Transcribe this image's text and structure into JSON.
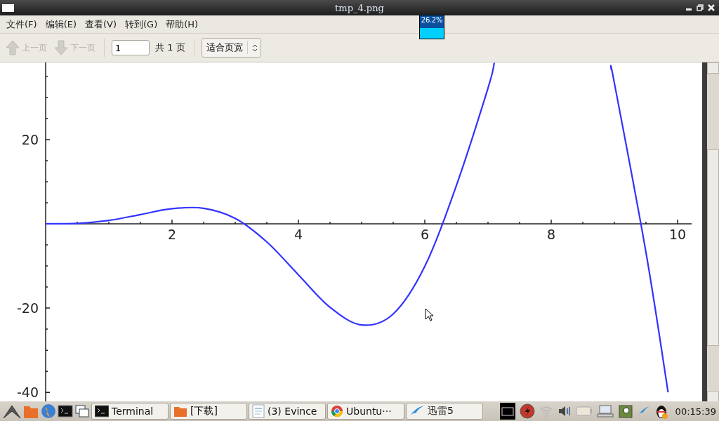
{
  "window": {
    "title": "tmp_4.png"
  },
  "menu": [
    "文件(F)",
    "编辑(E)",
    "查看(V)",
    "转到(G)",
    "帮助(H)"
  ],
  "toolbar": {
    "prev": {
      "label": "上一页",
      "disabled": true
    },
    "next": {
      "label": "下一页",
      "disabled": true
    },
    "page_field": {
      "value": "1"
    },
    "page_count": "共 1 页",
    "zoom": {
      "value": "适合页宽"
    }
  },
  "cpu_monitor": {
    "reading": "26.2%"
  },
  "document": {
    "chart_data": {
      "type": "line",
      "x": [
        0,
        0.5,
        1,
        1.5,
        2,
        2.5,
        3,
        3.5,
        4,
        4.5,
        5,
        5.5,
        6,
        6.5,
        7,
        7.1,
        8.95,
        9,
        9.5,
        9.85
      ],
      "series": [
        {
          "color": "#3333ff",
          "values": [
            0,
            0.1,
            0.8,
            2.2,
            3.6,
            3.7,
            1.3,
            -4.3,
            -12.1,
            -19.8,
            -24,
            -21.4,
            -10.1,
            9.1,
            32.2,
            38.2,
            null,
            null,
            null,
            null
          ]
        },
        {
          "color": "#3333ff",
          "values": [
            null,
            null,
            null,
            null,
            null,
            null,
            null,
            null,
            null,
            null,
            null,
            null,
            null,
            null,
            null,
            null,
            36.6,
            33.4,
            -6.8,
            -40
          ]
        }
      ],
      "xlim": [
        0,
        10.2
      ],
      "ylim": [
        -42.3,
        38.3
      ],
      "xticks": [
        2,
        4,
        6,
        8,
        10
      ],
      "yticks": [
        -40,
        -20,
        20
      ]
    }
  },
  "taskbar": {
    "tasks": [
      {
        "label": "Terminal",
        "kind": "terminal"
      },
      {
        "label": "[下载]",
        "kind": "folder"
      },
      {
        "label": "(3) Evince",
        "kind": "document"
      },
      {
        "label": "Ubuntu···",
        "kind": "browser"
      },
      {
        "label": "迅雷5",
        "kind": "bird"
      }
    ],
    "clock": "00:15:39"
  }
}
